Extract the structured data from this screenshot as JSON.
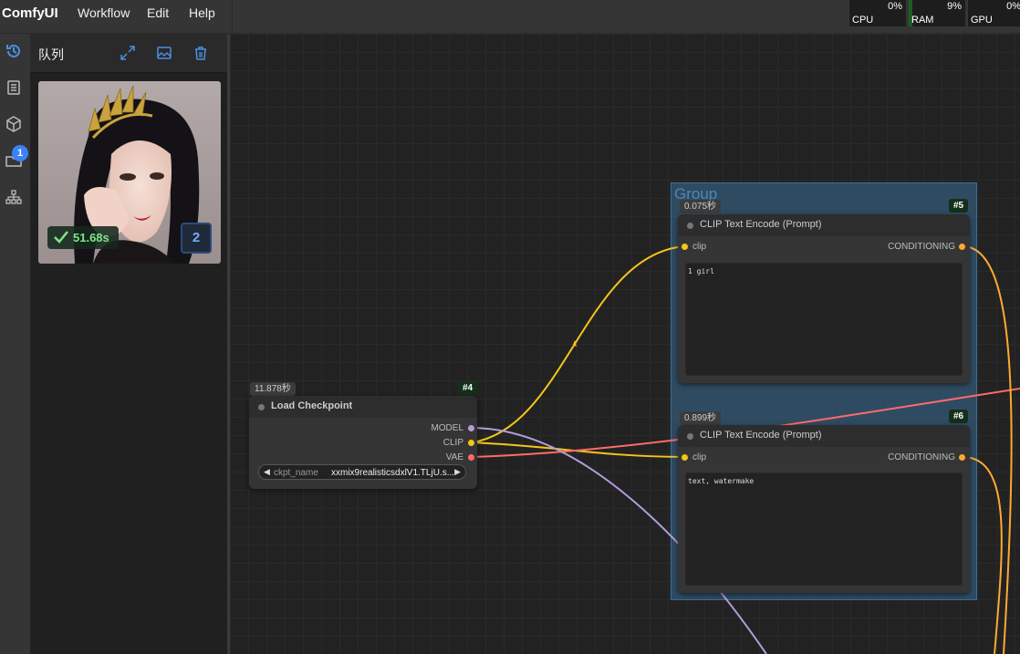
{
  "app": {
    "logo": "ComfyUI",
    "menu": [
      "Workflow",
      "Edit",
      "Help"
    ]
  },
  "stats": [
    {
      "label": "CPU",
      "value": "0%",
      "usage": 0.0
    },
    {
      "label": "RAM",
      "value": "9%",
      "usage": 0.09
    },
    {
      "label": "GPU",
      "value": "0%",
      "usage": 0.0
    }
  ],
  "sidebar": {
    "icons": [
      "history-icon",
      "document-icon",
      "cube-icon",
      "folder-icon",
      "node-tree-icon"
    ],
    "badge": "1"
  },
  "queue": {
    "title": "队列",
    "item": {
      "duration": "51.68s",
      "count": "2"
    }
  },
  "group": {
    "title": "Group"
  },
  "nodes": {
    "load_checkpoint": {
      "id": "#4",
      "timer": "11.878秒",
      "title": "Load Checkpoint",
      "outputs": [
        "MODEL",
        "CLIP",
        "VAE"
      ],
      "widget": {
        "name": "ckpt_name",
        "value": "xxmix9realisticsdxlV1.TLjU.s..."
      }
    },
    "clip_positive": {
      "id": "#5",
      "timer": "0.075秒",
      "title": "CLIP Text Encode (Prompt)",
      "input": "clip",
      "output": "CONDITIONING",
      "text": "1 girl"
    },
    "clip_negative": {
      "id": "#6",
      "timer": "0.899秒",
      "title": "CLIP Text Encode (Prompt)",
      "input": "clip",
      "output": "CONDITIONING",
      "text": "text, watermake"
    }
  },
  "colors": {
    "clip": "#f5c518",
    "model": "#b39ddb",
    "vae": "#ff6b6b",
    "conditioning": "#ffa931",
    "group": "#345a78",
    "node": "#353535"
  }
}
